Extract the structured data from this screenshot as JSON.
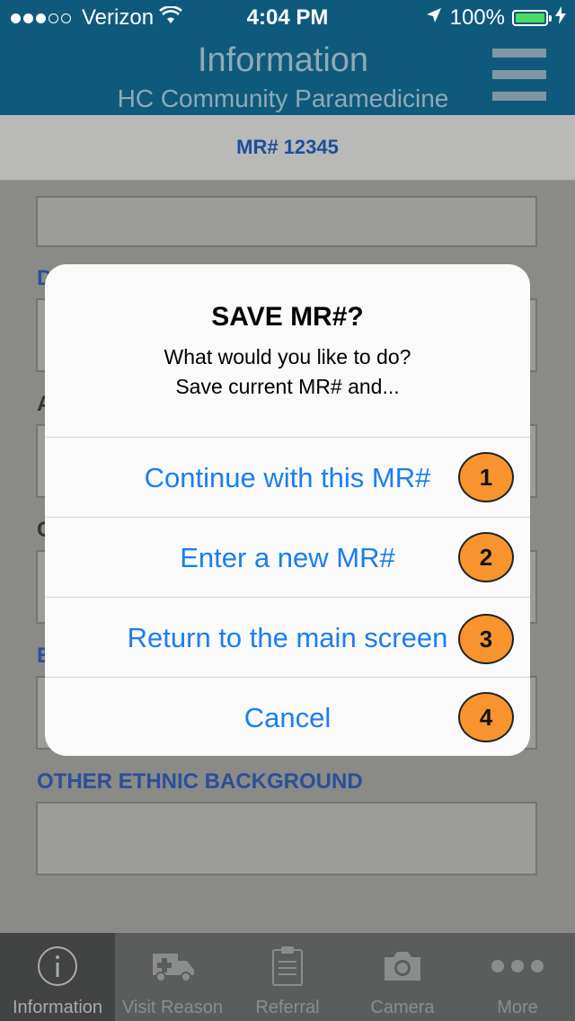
{
  "status_bar": {
    "carrier": "Verizon",
    "time": "4:04 PM",
    "battery": "100%",
    "signal_bars_filled": 3,
    "signal_bars_total": 5
  },
  "header": {
    "title": "Information",
    "subtitle": "HC Community Paramedicine",
    "menu_icon": "hamburger-menu-icon"
  },
  "mr_banner": "MR# 12345",
  "form": {
    "visible_label": "OTHER ETHNIC BACKGROUND",
    "partial_labels": [
      "D",
      "A",
      "C",
      "E"
    ]
  },
  "dialog": {
    "title": "SAVE MR#?",
    "message_line1": "What would you like to do?",
    "message_line2": "Save current MR# and...",
    "buttons": [
      {
        "label": "Continue with this MR#",
        "badge": "1"
      },
      {
        "label": "Enter a new MR#",
        "badge": "2"
      },
      {
        "label": "Return to the main screen",
        "badge": "3"
      },
      {
        "label": "Cancel",
        "badge": "4"
      }
    ]
  },
  "tabs": [
    {
      "label": "Information",
      "icon": "info-icon",
      "active": true
    },
    {
      "label": "Visit Reason",
      "icon": "ambulance-icon",
      "active": false
    },
    {
      "label": "Referral",
      "icon": "clipboard-icon",
      "active": false
    },
    {
      "label": "Camera",
      "icon": "camera-icon",
      "active": false
    },
    {
      "label": "More",
      "icon": "more-dots-icon",
      "active": false
    }
  ],
  "colors": {
    "header_bg": "#0f5a7c",
    "link_blue": "#1a7ef2",
    "label_blue": "#2c4f98",
    "badge_orange": "#f7942d",
    "battery_green": "#4cd964"
  }
}
